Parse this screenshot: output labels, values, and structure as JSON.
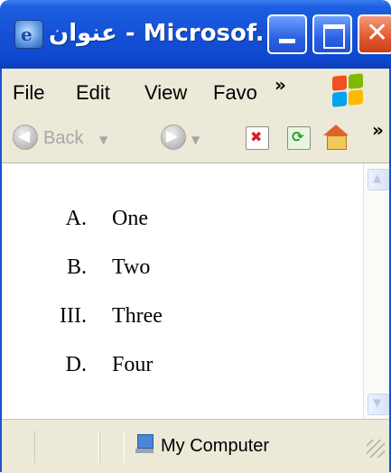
{
  "window": {
    "title": "عنوان - Microsof...",
    "icon": "ie-document-icon",
    "buttons": [
      "minimize",
      "maximize",
      "close"
    ]
  },
  "menubar": {
    "items": [
      "File",
      "Edit",
      "View",
      "Favo"
    ],
    "more": "»"
  },
  "toolbar": {
    "back_label": "Back",
    "more": "»",
    "icons": [
      "back-icon",
      "forward-icon",
      "stop-icon",
      "refresh-icon",
      "home-icon"
    ]
  },
  "content": {
    "list": [
      {
        "marker": "A.",
        "text": "One"
      },
      {
        "marker": "B.",
        "text": "Two"
      },
      {
        "marker": "III.",
        "text": "Three"
      },
      {
        "marker": "D.",
        "text": "Four"
      }
    ]
  },
  "statusbar": {
    "zone": "My Computer"
  }
}
